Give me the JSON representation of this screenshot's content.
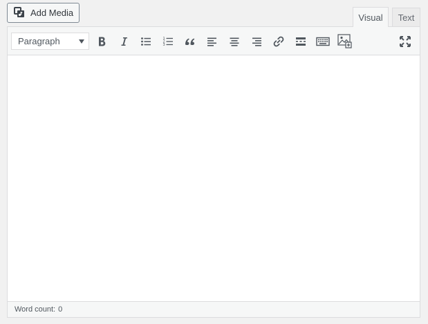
{
  "add_media": {
    "label": "Add Media",
    "icon": "media-icon"
  },
  "tabs": [
    {
      "label": "Visual",
      "active": true
    },
    {
      "label": "Text",
      "active": false
    }
  ],
  "toolbar": {
    "format_select": {
      "value": "Paragraph",
      "icon": "chevron-down-icon"
    },
    "buttons": [
      {
        "name": "bold",
        "icon": "bold-icon"
      },
      {
        "name": "italic",
        "icon": "italic-icon"
      },
      {
        "name": "bulleted-list",
        "icon": "bulleted-list-icon"
      },
      {
        "name": "numbered-list",
        "icon": "numbered-list-icon"
      },
      {
        "name": "blockquote",
        "icon": "blockquote-icon"
      },
      {
        "name": "align-left",
        "icon": "align-left-icon"
      },
      {
        "name": "align-center",
        "icon": "align-center-icon"
      },
      {
        "name": "align-right",
        "icon": "align-right-icon"
      },
      {
        "name": "insert-link",
        "icon": "link-icon"
      },
      {
        "name": "read-more",
        "icon": "read-more-icon"
      },
      {
        "name": "toolbar-toggle",
        "icon": "keyboard-icon"
      },
      {
        "name": "insert-image",
        "icon": "image-icon"
      },
      {
        "name": "fullscreen",
        "icon": "fullscreen-icon"
      }
    ]
  },
  "status": {
    "word_count_label": "Word count:",
    "word_count": "0"
  },
  "colors": {
    "icon": "#50575e",
    "border": "#dcdcde",
    "toolbar_bg": "#f6f7f7",
    "page_bg": "#f1f1f1"
  }
}
